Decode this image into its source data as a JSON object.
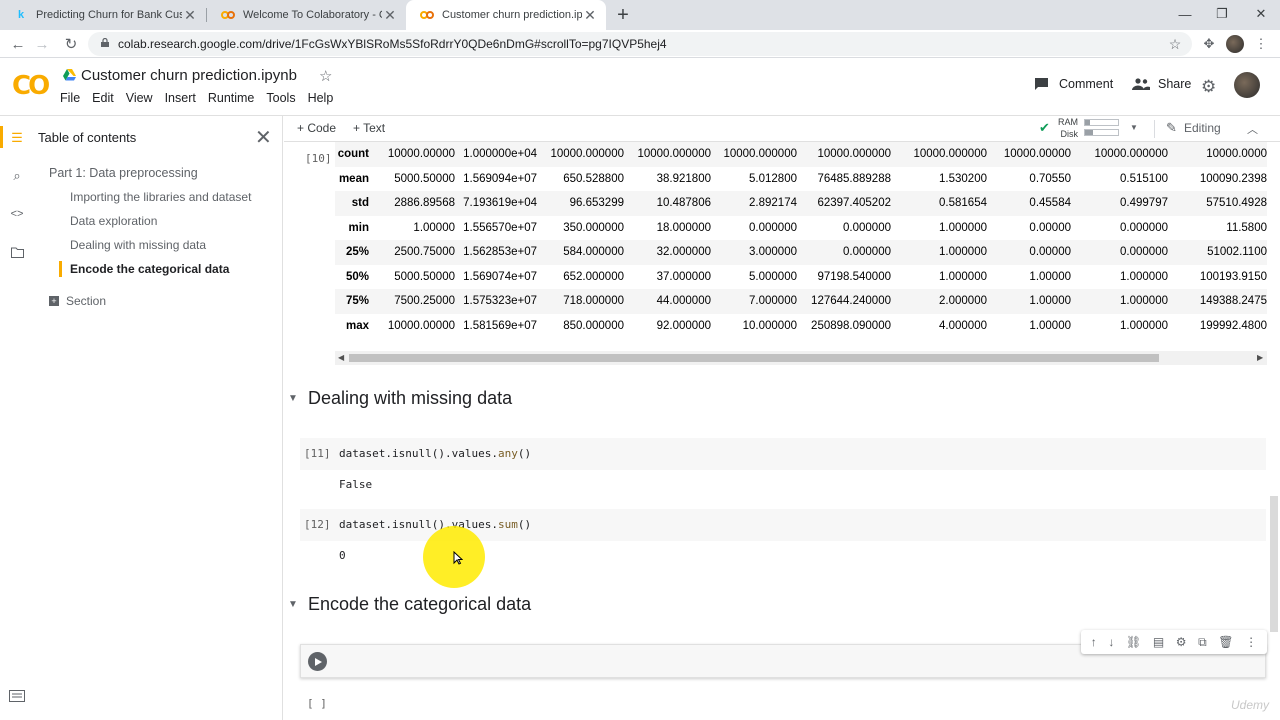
{
  "browser": {
    "tabs": [
      {
        "label": "Predicting Churn for Bank Custom",
        "icon": "kaggle-icon",
        "active": false
      },
      {
        "label": "Welcome To Colaboratory - Colab",
        "icon": "colab-icon",
        "active": false
      },
      {
        "label": "Customer churn prediction.ipynb",
        "icon": "colab-icon",
        "active": true
      }
    ],
    "url": "colab.research.google.com/drive/1FcGsWxYBlSRoMs5SfoRdrrY0QDe6nDmG#scrollTo=pg7IQVP5hej4"
  },
  "colab": {
    "notebook_title": "Customer churn prediction.ipynb",
    "menu": [
      "File",
      "Edit",
      "View",
      "Insert",
      "Runtime",
      "Tools",
      "Help"
    ],
    "comment_label": "Comment",
    "share_label": "Share",
    "toolbar": {
      "code_label": "+ Code",
      "text_label": "+ Text",
      "ram_label": "RAM",
      "disk_label": "Disk",
      "editing_label": "Editing"
    }
  },
  "sidebar": {
    "title": "Table of contents",
    "items": [
      {
        "label": "Part 1: Data preprocessing",
        "level": 1,
        "current": false
      },
      {
        "label": "Importing the libraries and dataset",
        "level": 2,
        "current": false
      },
      {
        "label": "Data exploration",
        "level": 2,
        "current": false
      },
      {
        "label": "Dealing with missing data",
        "level": 2,
        "current": false
      },
      {
        "label": "Encode the categorical data",
        "level": 2,
        "current": true
      }
    ],
    "add_section_label": "Section"
  },
  "notebook": {
    "describe_output": {
      "count_label": "[10]",
      "rows": [
        [
          "count",
          "10000.00000",
          "1.000000e+04",
          "10000.000000",
          "10000.000000",
          "10000.000000",
          "10000.000000",
          "10000.000000",
          "10000.00000",
          "10000.000000",
          "10000.0000"
        ],
        [
          "mean",
          "5000.50000",
          "1.569094e+07",
          "650.528800",
          "38.921800",
          "5.012800",
          "76485.889288",
          "1.530200",
          "0.70550",
          "0.515100",
          "100090.2398"
        ],
        [
          "std",
          "2886.89568",
          "7.193619e+04",
          "96.653299",
          "10.487806",
          "2.892174",
          "62397.405202",
          "0.581654",
          "0.45584",
          "0.499797",
          "57510.4928"
        ],
        [
          "min",
          "1.00000",
          "1.556570e+07",
          "350.000000",
          "18.000000",
          "0.000000",
          "0.000000",
          "1.000000",
          "0.00000",
          "0.000000",
          "11.5800"
        ],
        [
          "25%",
          "2500.75000",
          "1.562853e+07",
          "584.000000",
          "32.000000",
          "3.000000",
          "0.000000",
          "1.000000",
          "0.00000",
          "0.000000",
          "51002.1100"
        ],
        [
          "50%",
          "5000.50000",
          "1.569074e+07",
          "652.000000",
          "37.000000",
          "5.000000",
          "97198.540000",
          "1.000000",
          "1.00000",
          "1.000000",
          "100193.9150"
        ],
        [
          "75%",
          "7500.25000",
          "1.575323e+07",
          "718.000000",
          "44.000000",
          "7.000000",
          "127644.240000",
          "2.000000",
          "1.00000",
          "1.000000",
          "149388.2475"
        ],
        [
          "max",
          "10000.00000",
          "1.581569e+07",
          "850.000000",
          "92.000000",
          "10.000000",
          "250898.090000",
          "4.000000",
          "1.00000",
          "1.000000",
          "199992.4800"
        ]
      ]
    },
    "section_missing": "Dealing with missing data",
    "cell11": {
      "count": "[11]",
      "obj": "dataset.isnull().values.",
      "fn": "any",
      "tail": "()",
      "output": "False"
    },
    "cell12": {
      "count": "[12]",
      "obj": "dataset.isnull().values.",
      "fn": "sum",
      "tail": "()",
      "output": "0"
    },
    "section_encode": "Encode the categorical data",
    "empty_cell_count": "[ ]",
    "watermark": "Udemy"
  }
}
